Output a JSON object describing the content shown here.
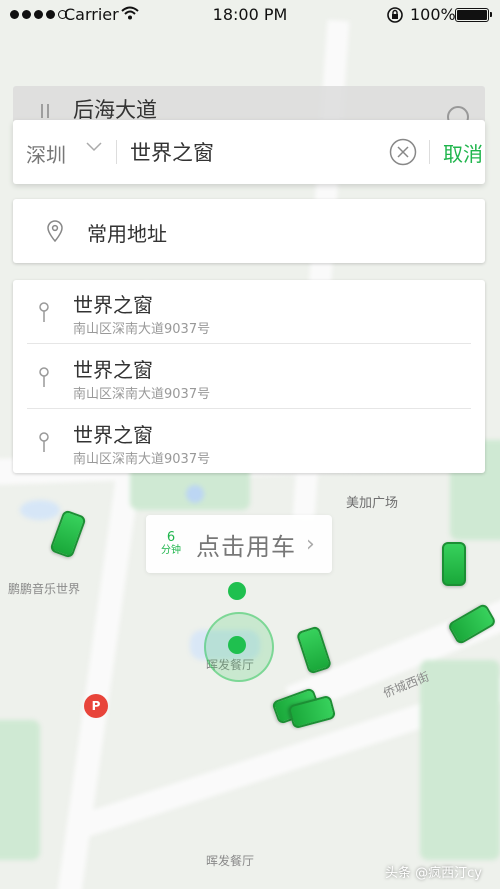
{
  "status_bar": {
    "carrier": "Carrier",
    "time": "18:00 PM",
    "battery": "100%",
    "icons": [
      "signal-dots-icon",
      "wifi-icon",
      "orientation-lock-icon",
      "battery-icon"
    ]
  },
  "background_entry": {
    "title": "后海大道"
  },
  "search": {
    "city": "深圳",
    "query": "世界之窗",
    "cancel_label": "取消"
  },
  "common_address": {
    "label": "常用地址"
  },
  "results": [
    {
      "name": "世界之窗",
      "address": "南山区深南大道9037号"
    },
    {
      "name": "世界之窗",
      "address": "南山区深南大道9037号"
    },
    {
      "name": "世界之窗",
      "address": "南山区深南大道9037号"
    }
  ],
  "map": {
    "call_car_label": "点击用车",
    "eta_value": "6",
    "eta_unit": "分钟",
    "labels": {
      "music_world": "鹏鹏音乐世界",
      "meijia": "美加广场",
      "restaurant": "晖发餐厅",
      "road": "侨城西街",
      "restaurant2": "晖发餐厅"
    },
    "accent_color": "#1fb54c"
  },
  "watermark": "头条 @疯西汀cy"
}
